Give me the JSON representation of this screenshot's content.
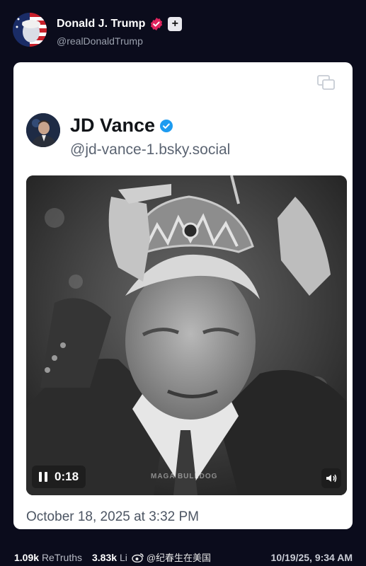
{
  "author": {
    "name": "Donald J. Trump",
    "handle": "@realDonaldTrump",
    "verified_icon": "verified-badge-icon",
    "follow_icon": "plus-icon",
    "follow_label": "+"
  },
  "quoted_post": {
    "author_name": "JD Vance",
    "author_handle": "@jd-vance-1.bsky.social",
    "verified_icon": "verified-badge-icon",
    "video": {
      "time": "0:18",
      "watermark": "MAGA BULLDOG",
      "controls": [
        "pause-icon",
        "volume-icon"
      ]
    },
    "date": "October 18, 2025 at 3:32 PM"
  },
  "footer": {
    "retruths_count": "1.09k",
    "retruths_label": "ReTruths",
    "likes_count": "3.83k",
    "likes_label": "Li",
    "weibo_text": "@纪春生在美国",
    "timestamp": "10/19/25, 9:34 AM"
  },
  "colors": {
    "background": "#0b0c1c",
    "card": "#ffffff",
    "verified_pink": "#e0245e",
    "verified_blue": "#1d9bf0"
  }
}
